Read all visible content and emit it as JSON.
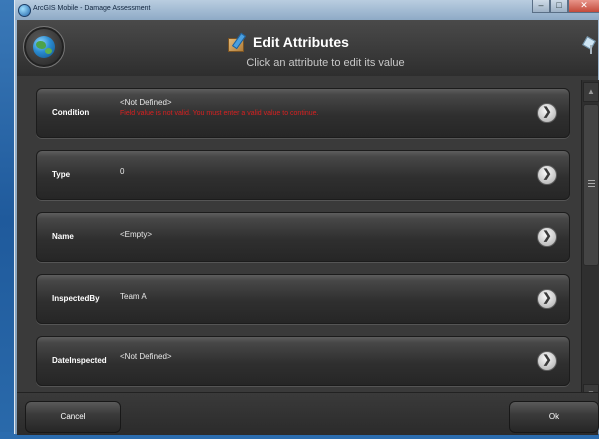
{
  "window": {
    "title": "ArcGIS Mobile - Damage Assessment",
    "minimize_label": "–",
    "maximize_label": "□",
    "close_label": "✕"
  },
  "header": {
    "title": "Edit Attributes",
    "subtitle": "Click an attribute to edit its value"
  },
  "attributes": [
    {
      "label": "Condition",
      "value": "<Not Defined>",
      "error": "Field value is not valid. You must enter a valid value to continue."
    },
    {
      "label": "Type",
      "value": "0"
    },
    {
      "label": "Name",
      "value": "<Empty>"
    },
    {
      "label": "InspectedBy",
      "value": "Team A"
    },
    {
      "label": "DateInspected",
      "value": "<Not Defined>"
    }
  ],
  "chevron_glyph": "❯",
  "scroll": {
    "up_glyph": "▲",
    "down_glyph": "▼"
  },
  "footer": {
    "cancel_label": "Cancel",
    "ok_label": "Ok"
  },
  "colors": {
    "error_text": "#d82020",
    "panel_background": "#3a3a3a"
  }
}
